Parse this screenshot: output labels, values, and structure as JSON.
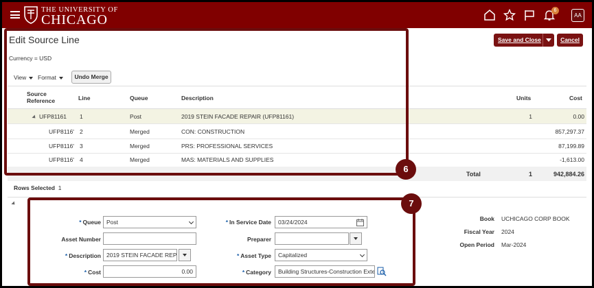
{
  "header": {
    "logo_top": "THE UNIVERSITY OF",
    "logo_main": "CHICAGO",
    "notification_count": "6",
    "avatar": "AA",
    "brand_color": "#800000"
  },
  "page": {
    "title": "Edit Source Line",
    "currency": "Currency = USD",
    "save_close": "Save and Close",
    "cancel": "Cancel"
  },
  "toolbar": {
    "view": "View",
    "format": "Format",
    "undo_merge": "Undo Merge"
  },
  "table": {
    "headers": {
      "source_ref_1": "Source",
      "source_ref_2": "Reference",
      "line": "Line",
      "queue": "Queue",
      "description": "Description",
      "units": "Units",
      "cost": "Cost"
    },
    "rows": [
      {
        "ref": "UFP81161",
        "line": "1",
        "queue": "Post",
        "description": "2019 STEIN FACADE REPAIR (UFP81161)",
        "units": "1",
        "cost": "0.00"
      },
      {
        "ref": "UFP8116'",
        "line": "2",
        "queue": "Merged",
        "description": "CON: CONSTRUCTION",
        "units": "",
        "cost": "857,297.37"
      },
      {
        "ref": "UFP8116'",
        "line": "3",
        "queue": "Merged",
        "description": "PRS: PROFESSIONAL SERVICES",
        "units": "",
        "cost": "87,199.89"
      },
      {
        "ref": "UFP8116'",
        "line": "4",
        "queue": "Merged",
        "description": "MAS: MATERIALS AND SUPPLIES",
        "units": "",
        "cost": "-1,613.00"
      }
    ],
    "total": {
      "label": "Total",
      "units": "1",
      "cost": "942,884.26"
    }
  },
  "rows_selected": {
    "label": "Rows Selected",
    "value": "1"
  },
  "form": {
    "queue_label": "Queue",
    "queue_value": "Post",
    "in_service_label": "In Service Date",
    "in_service_value": "03/24/2024",
    "asset_number_label": "Asset Number",
    "asset_number_value": "",
    "preparer_label": "Preparer",
    "preparer_value": "",
    "description_label": "Description",
    "description_value": "2019 STEIN FACADE REPA",
    "asset_type_label": "Asset Type",
    "asset_type_value": "Capitalized",
    "cost_label": "Cost",
    "cost_value": "0.00",
    "category_label": "Category",
    "category_value": "Building Structures-Construction Exteri"
  },
  "side": {
    "book_label": "Book",
    "book_value": "UCHICAGO CORP BOOK",
    "fiscal_year_label": "Fiscal Year",
    "fiscal_year_value": "2024",
    "open_period_label": "Open Period",
    "open_period_value": "Mar-2024"
  },
  "callouts": {
    "first": "6",
    "second": "7"
  }
}
